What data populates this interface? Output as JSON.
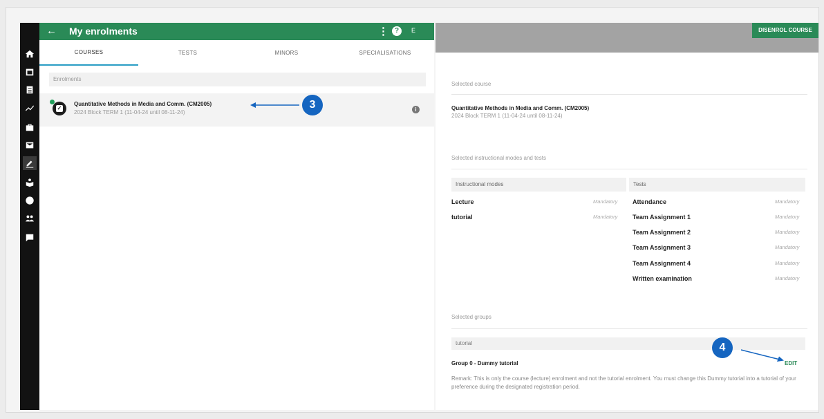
{
  "app": {
    "title": "My enrolments",
    "back_icon": "arrow-left-icon",
    "more_icon": "more-vert-icon",
    "help_icon": "help-icon",
    "user_initial": "E",
    "accent": "#2a8a57"
  },
  "tabs": [
    {
      "label": "COURSES",
      "active": true
    },
    {
      "label": "TESTS",
      "active": false
    },
    {
      "label": "MINORS",
      "active": false
    },
    {
      "label": "SPECIALISATIONS",
      "active": false
    }
  ],
  "enrolments": {
    "header": "Enrolments",
    "items": [
      {
        "name": "Quantitative Methods in Media and Comm. (CM2005)",
        "subtitle": "2024 Block TERM 1 (11-04-24 until 08-11-24)",
        "icon": "checkbox-icon",
        "info_icon": "info-icon"
      }
    ]
  },
  "callouts": {
    "first": "3",
    "second": "4"
  },
  "right": {
    "disenrol_label": "DISENROL COURSE",
    "selected_course_label": "Selected course",
    "course_name": "Quantitative Methods in Media and Comm. (CM2005)",
    "course_subtitle": "2024 Block TERM 1 (11-04-24 until 08-11-24)",
    "modes_tests_label": "Selected instructional modes and tests",
    "modes_header": "Instructional modes",
    "tests_header": "Tests",
    "modes": [
      {
        "name": "Lecture",
        "req": "Mandatory"
      },
      {
        "name": "tutorial",
        "req": "Mandatory"
      }
    ],
    "tests": [
      {
        "name": "Attendance",
        "req": "Mandatory"
      },
      {
        "name": "Team Assignment 1",
        "req": "Mandatory"
      },
      {
        "name": "Team Assignment 2",
        "req": "Mandatory"
      },
      {
        "name": "Team Assignment 3",
        "req": "Mandatory"
      },
      {
        "name": "Team Assignment 4",
        "req": "Mandatory"
      },
      {
        "name": "Written examination",
        "req": "Mandatory"
      }
    ],
    "groups_label": "Selected groups",
    "group_header": "tutorial",
    "group_name": "Group 0 - Dummy tutorial",
    "edit_label": "EDIT",
    "remark": "Remark: This is only the course (lecture) enrolment and not the tutorial enrolment. You must change this Dummy tutorial into a tutorial of your preference during the designated registration period."
  },
  "sidebar_icons": [
    "home-icon",
    "calendar-icon",
    "list-icon",
    "trend-icon",
    "briefcase-icon",
    "mail-icon",
    "edit-icon",
    "learning-icon",
    "globe-icon",
    "people-icon",
    "feedback-icon"
  ]
}
